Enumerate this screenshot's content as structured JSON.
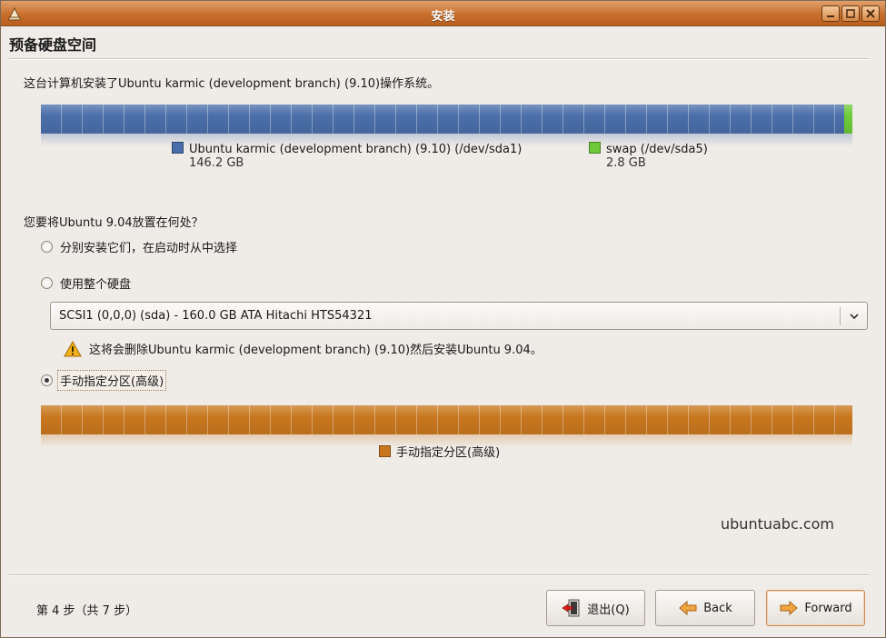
{
  "window": {
    "title": "安装"
  },
  "page": {
    "heading": "预备硬盘空间",
    "intro": "这台计算机安装了Ubuntu karmic (development branch) (9.10)操作系统。"
  },
  "current_layout": {
    "partitions": [
      {
        "label": "Ubuntu karmic (development branch) (9.10) (/dev/sda1)",
        "size": "146.2 GB",
        "size_gb": 146.2,
        "color": "#4a6ea9"
      },
      {
        "label": "swap (/dev/sda5)",
        "size": "2.8 GB",
        "size_gb": 2.8,
        "color": "#6ec93a"
      }
    ]
  },
  "question": "您要将Ubuntu 9.04放置在何处？",
  "options": [
    {
      "label": "分别安装它们，在启动时从中选择",
      "selected": false
    },
    {
      "label": "使用整个硬盘",
      "selected": false
    },
    {
      "label": "手动指定分区(高级)",
      "selected": true
    }
  ],
  "disk_select": {
    "value": "SCSI1 (0,0,0) (sda) - 160.0 GB ATA Hitachi HTS54321"
  },
  "warning": "这将会删除Ubuntu karmic (development branch) (9.10)然后安装Ubuntu 9.04。",
  "new_layout": {
    "partitions": [
      {
        "label": "手动指定分区(高级)",
        "color": "#c8771e"
      }
    ]
  },
  "watermark": "ubuntuabc.com",
  "footer": {
    "step": "第 4 步（共 7 步）",
    "quit_label": "退出(Q)",
    "back_label": "Back",
    "forward_label": "Forward"
  },
  "colors": {
    "titlebar": "#c86f2e",
    "accent": "#d78846"
  }
}
